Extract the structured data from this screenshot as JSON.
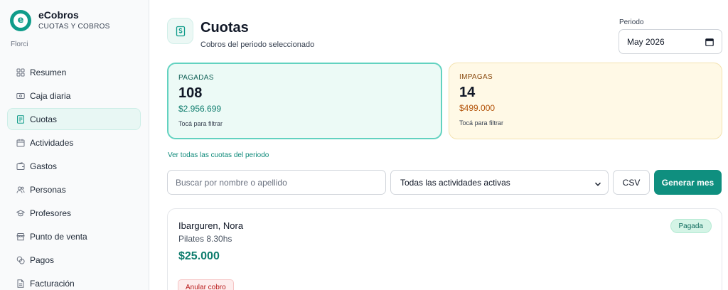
{
  "brand": {
    "name": "eCobros",
    "subtitle": "CUOTAS Y COBROS",
    "logo_letter": "e",
    "org": "Florci"
  },
  "nav": {
    "items": [
      {
        "label": "Resumen",
        "icon": "grid-icon",
        "active": false
      },
      {
        "label": "Caja diaria",
        "icon": "cash-icon",
        "active": false
      },
      {
        "label": "Cuotas",
        "icon": "receipt-icon",
        "active": true
      },
      {
        "label": "Actividades",
        "icon": "calendar-icon",
        "active": false
      },
      {
        "label": "Gastos",
        "icon": "wallet-icon",
        "active": false
      },
      {
        "label": "Personas",
        "icon": "users-icon",
        "active": false
      },
      {
        "label": "Profesores",
        "icon": "graduation-cap-icon",
        "active": false
      },
      {
        "label": "Punto de venta",
        "icon": "store-icon",
        "active": false
      },
      {
        "label": "Pagos",
        "icon": "coins-icon",
        "active": false
      },
      {
        "label": "Facturación",
        "icon": "document-icon",
        "active": false
      }
    ]
  },
  "header": {
    "title": "Cuotas",
    "subtitle": "Cobros del periodo seleccionado",
    "icon": "dollar-receipt-icon"
  },
  "period": {
    "label": "Periodo",
    "value": "May 2026"
  },
  "cards": {
    "paid": {
      "label": "PAGADAS",
      "count": "108",
      "amount": "$2.956.699",
      "hint": "Tocá para filtrar"
    },
    "unpaid": {
      "label": "IMPAGAS",
      "count": "14",
      "amount": "$499.000",
      "hint": "Tocá para filtrar"
    }
  },
  "all_link": "Ver todas las cuotas del periodo",
  "filters": {
    "search_placeholder": "Buscar por nombre o apellido",
    "activity_select": "Todas las actividades activas",
    "csv_label": "CSV",
    "generate_label": "Generar mes"
  },
  "entries": [
    {
      "name": "Ibarguren, Nora",
      "activity": "Pilates 8.30hs",
      "amount": "$25.000",
      "status": "Pagada",
      "annul_label": "Anular cobro"
    }
  ],
  "colors": {
    "accent": "#0f8f7f",
    "paid_bg": "#ecfaf6",
    "unpaid_bg": "#fff9e6",
    "danger": "#b91c1c"
  }
}
